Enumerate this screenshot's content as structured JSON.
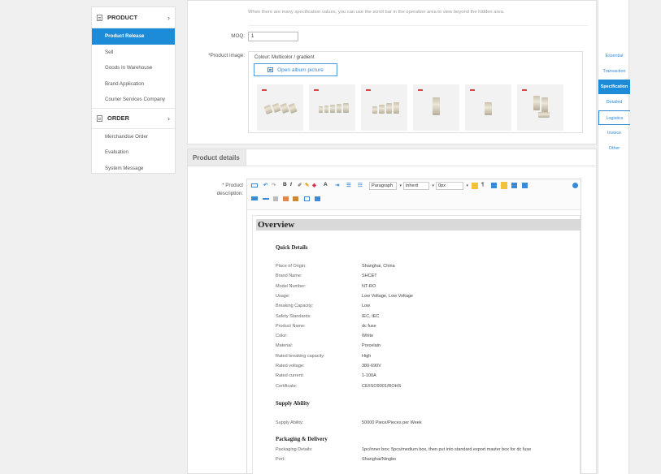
{
  "sidebar": {
    "product_label": "PRODUCT",
    "order_label": "ORDER",
    "product_items": [
      "Product Release",
      "Sell",
      "Goods In Warehouse",
      "Brand Application",
      "Courier Services Company"
    ],
    "order_items": [
      "Merchandise Order",
      "Evaluation",
      "System Message"
    ]
  },
  "spec": {
    "hint": "When there are many specification values, you can use the scroll bar in the operation area to view beyond the hidden area.",
    "moq_label": "MOQ:",
    "moq_value": "1",
    "image_label": "*Product image:",
    "colour_label": "Colour: Multicolor / gradient",
    "album_button": "Open album picture"
  },
  "details": {
    "section_title": "Product details",
    "desc_label_1": "* Product",
    "desc_label_2": "description:"
  },
  "toolbar": {
    "paragraph": "Paragraph",
    "font": "inherit",
    "size": "0px"
  },
  "doc": {
    "overview": "Overview",
    "quick_details": "Quick Details",
    "rows": [
      {
        "k": "Place of Origin:",
        "v": "Shanghai, China"
      },
      {
        "k": "Brand Name:",
        "v": "SHCET"
      },
      {
        "k": "Model Number:",
        "v": "NT-RO"
      },
      {
        "k": "Usage:",
        "v": "Low Voltage, Low Voltage"
      },
      {
        "k": "Breaking Capacity:",
        "v": "Low"
      },
      {
        "k": "Safety Standards:",
        "v": "IEC, IEC"
      },
      {
        "k": "Product Name:",
        "v": "dc fuse"
      },
      {
        "k": "Color:",
        "v": "White"
      },
      {
        "k": "Material:",
        "v": "Porcelain"
      },
      {
        "k": "Rated breaking capacity:",
        "v": "High"
      },
      {
        "k": "Rated voltage:",
        "v": "380-690V"
      },
      {
        "k": "Rated current:",
        "v": "1-100A"
      },
      {
        "k": "Certificate:",
        "v": "CE/ISO9001/ROHS"
      }
    ],
    "supply_ability": "Supply Ability",
    "supply_row": {
      "k": "Supply Ability:",
      "v": "50000 Piece/Pieces per Week"
    },
    "packaging": "Packaging & Delivery",
    "packaging_rows": [
      {
        "k": "Packaging Details:",
        "v": "1pc/inner box; 5pcs/medium box, then put into standard export master box for dc fuse"
      },
      {
        "k": "Port:",
        "v": "Shanghai/Ningbo"
      }
    ]
  },
  "rail": [
    "Essential",
    "Transaction",
    "Specification",
    "Detailed",
    "Logistics",
    "Invoice",
    "Other"
  ],
  "colors": {
    "accent": "#1c8bd8",
    "link": "#2f8ad6",
    "required": "#e22222"
  }
}
